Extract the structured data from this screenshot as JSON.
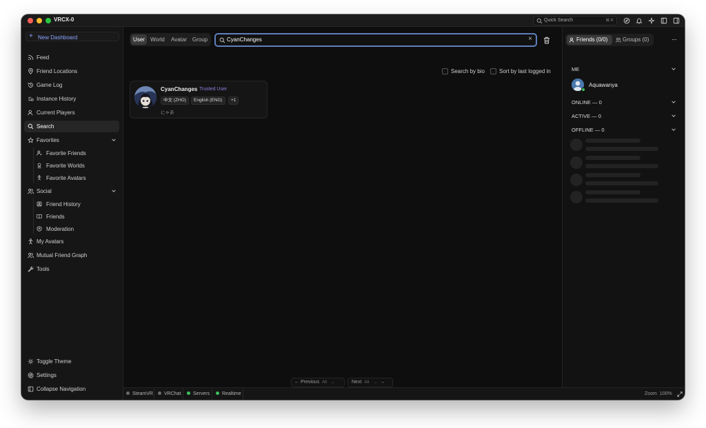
{
  "app": {
    "title": "VRCX-0"
  },
  "titlebar": {
    "quick_search": "Quick Search",
    "quick_search_kbd": "⌘ K",
    "icons": [
      "compass-icon",
      "bell-icon",
      "sparkle-icon",
      "sidebar-left-icon",
      "sidebar-right-icon"
    ]
  },
  "sidebar": {
    "new_dashboard": "New Dashboard",
    "items": [
      {
        "label": "Feed",
        "icon": "rss-icon"
      },
      {
        "label": "Friend Locations",
        "icon": "map-pin-icon"
      },
      {
        "label": "Game Log",
        "icon": "history-icon"
      },
      {
        "label": "Instance History",
        "icon": "list-icon"
      },
      {
        "label": "Current Players",
        "icon": "user-icon"
      },
      {
        "label": "Search",
        "icon": "search-icon",
        "active": true
      },
      {
        "label": "Favorites",
        "icon": "star-icon"
      },
      {
        "label": "Social",
        "icon": "users-icon"
      },
      {
        "label": "My Avatars",
        "icon": "person-icon"
      },
      {
        "label": "Mutual Friend Graph",
        "icon": "graph-icon"
      },
      {
        "label": "Tools",
        "icon": "wrench-icon"
      }
    ],
    "favorites_sub": [
      "Favorite Friends",
      "Favorite Worlds",
      "Favorite Avatars"
    ],
    "social_sub": [
      "Friend History",
      "Friends",
      "Moderation"
    ],
    "bottom": [
      "Toggle Theme",
      "Settings",
      "Collapse Navigation"
    ]
  },
  "main": {
    "tabs": [
      "User",
      "World",
      "Avatar",
      "Group"
    ],
    "active_tab": "User",
    "search_value": "CyanChanges",
    "clear_symbol": "×",
    "search_by_bio": "Search by bio",
    "sort_by_last_logged_in": "Sort by last logged in",
    "result": {
      "name": "CyanChanges",
      "trust": "Trusted User",
      "languages": [
        "中文 (ZHO)",
        "English (ENG)",
        "+1"
      ],
      "bio": "にゃあ"
    },
    "pager": {
      "previous": "Previous",
      "next": "Next",
      "kbd": "Alt",
      "left_arrow": "←",
      "right_arrow": "→"
    }
  },
  "right_panel": {
    "friends_tab": "Friends (0/0)",
    "groups_tab": "Groups (0)",
    "more": "···",
    "sections": [
      "ME",
      "ONLINE — 0",
      "ACTIVE — 0",
      "OFFLINE — 0"
    ],
    "me_name": "Aquawanya"
  },
  "statusbar": {
    "items": [
      {
        "label": "SteamVR",
        "status": "#6b6b6b"
      },
      {
        "label": "VRChat",
        "status": "#6b6b6b"
      },
      {
        "label": "Servers",
        "status": "#3bc15e"
      },
      {
        "label": "Realtime",
        "status": "#3bc15e"
      }
    ],
    "zoom_label": "Zoom",
    "zoom_value": "100%"
  },
  "colors": {
    "accent": "#8ea3ff",
    "trusted": "#8f7ddc",
    "online": "#3bc15e",
    "search_border": "#5f7fbf"
  }
}
